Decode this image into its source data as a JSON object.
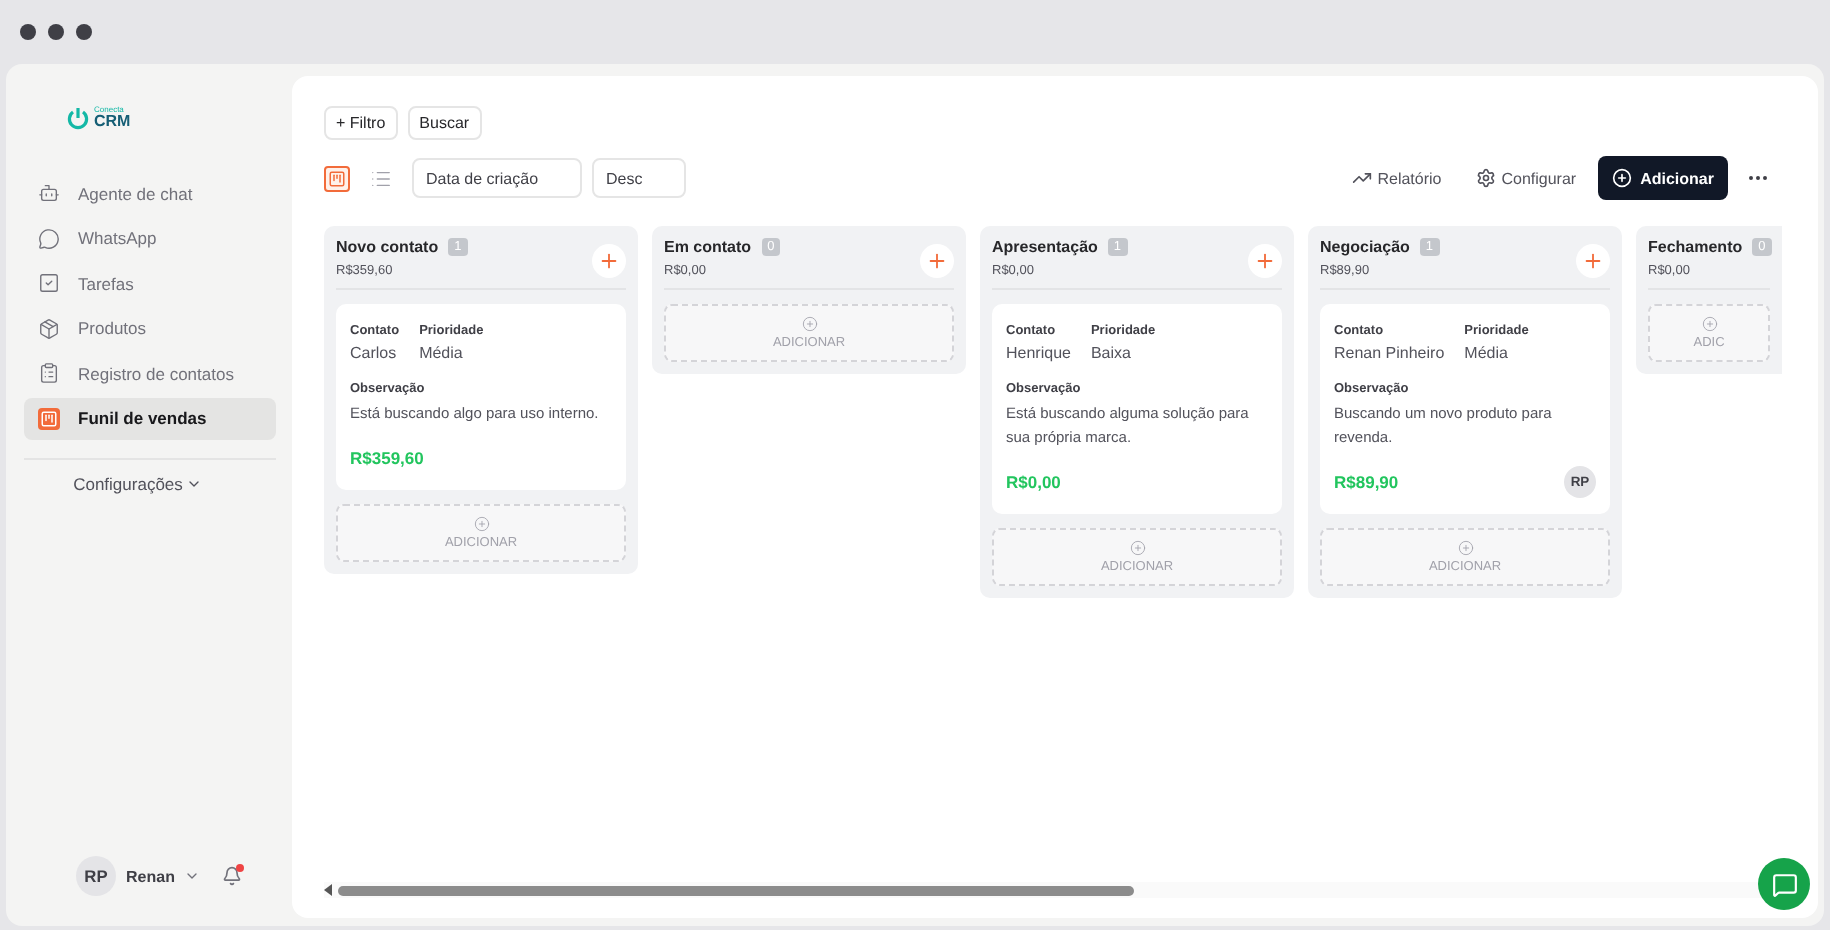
{
  "brand": {
    "tagline": "Conecta",
    "name": "CRM"
  },
  "sidebar": {
    "items": [
      {
        "kind": "bot",
        "label": "Agente de chat",
        "selected": false
      },
      {
        "kind": "chat",
        "label": "WhatsApp",
        "selected": false
      },
      {
        "kind": "task",
        "label": "Tarefas",
        "selected": false
      },
      {
        "kind": "box",
        "label": "Produtos",
        "selected": false
      },
      {
        "kind": "clipboard",
        "label": "Registro de contatos",
        "selected": false
      },
      {
        "kind": "board",
        "label": "Funil de vendas",
        "selected": true
      }
    ],
    "settings": "Configurações"
  },
  "user": {
    "initials": "RP",
    "name": "Renan",
    "notification": true
  },
  "toolbar": {
    "filter": "+ Filtro",
    "search": "Buscar",
    "views": [
      {
        "kind": "board",
        "selected": true
      },
      {
        "kind": "list",
        "selected": false
      }
    ],
    "sort_field": "Data de criação",
    "sort_order": "Desc",
    "report": "Relatório",
    "configure": "Configurar",
    "add": "Adicionar"
  },
  "columns": [
    {
      "name": "Novo contato",
      "count": "1",
      "total": "R$359,60",
      "add_label": "ADICIONAR",
      "cards": [
        {
          "contact_label": "Contato",
          "contact": "Carlos",
          "priority_label": "Prioridade",
          "priority": "Média",
          "note_label": "Observação",
          "note": "Está buscando algo para uso interno.",
          "value": "R$359,60"
        }
      ]
    },
    {
      "name": "Em contato",
      "count": "0",
      "total": "R$0,00",
      "add_label": "ADICIONAR"
    },
    {
      "name": "Apresentação",
      "count": "1",
      "total": "R$0,00",
      "add_label": "ADICIONAR",
      "cards": [
        {
          "contact_label": "Contato",
          "contact": "Henrique",
          "priority_label": "Prioridade",
          "priority": "Baixa",
          "note_label": "Observação",
          "note": "Está buscando alguma solução para sua própria marca.",
          "value": "R$0,00"
        }
      ]
    },
    {
      "name": "Negociação",
      "count": "1",
      "total": "R$89,90",
      "add_label": "ADICIONAR",
      "cards": [
        {
          "contact_label": "Contato",
          "contact": "Renan Pinheiro",
          "priority_label": "Prioridade",
          "priority": "Média",
          "note_label": "Observação",
          "note": "Buscando um novo produto para revenda.",
          "value": "R$89,90",
          "assignee": "RP"
        }
      ]
    },
    {
      "name": "Fechamento",
      "count": "0",
      "total": "R$0,00",
      "add_label": "ADIC"
    }
  ]
}
